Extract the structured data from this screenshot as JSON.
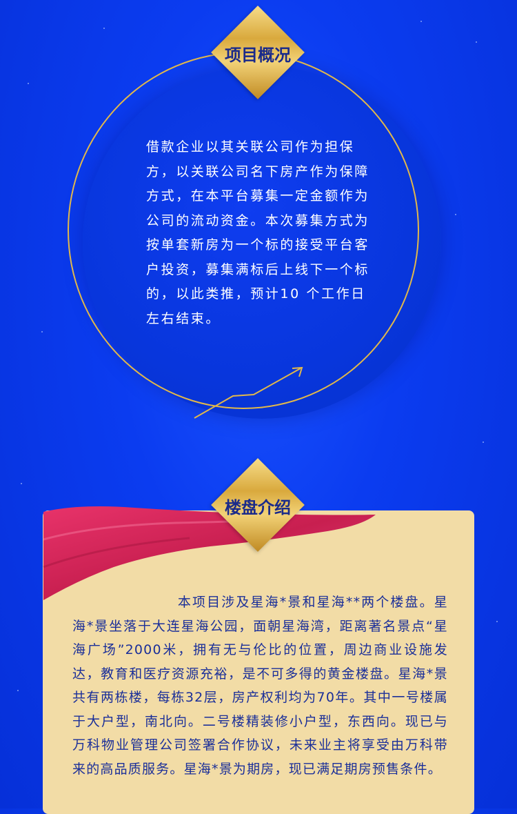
{
  "colors": {
    "background": "#0b3cf0",
    "gold": "#e2b84a",
    "card": "#f2dca6",
    "ribbon": "#d92a5e",
    "body_text_dark": "#1b2f99"
  },
  "project_overview": {
    "title": "项目概况",
    "body": "借款企业以其关联公司作为担保方，以关联公司名下房产作为保障方式，在本平台募集一定金额作为公司的流动资金。本次募集方式为按单套新房为一个标的接受平台客户投资，募集满标后上线下一个标的，以此类推，预计10 个工作日左右结束。"
  },
  "property_intro": {
    "title": "楼盘介绍",
    "body": "本项目涉及星海*景和星海**两个楼盘。星海*景坐落于大连星海公园，面朝星海湾，距离著名景点“星海广场”2000米，拥有无与伦比的位置，周边商业设施发达，教育和医疗资源充裕，是不可多得的黄金楼盘。星海*景共有两栋楼，每栋32层，房产权利均为70年。其中一号楼属于大户型，南北向。二号楼精装修小户型，东西向。现已与万科物业管理公司签署合作协议，未来业主将享受由万科带来的高品质服务。星海*景为期房，现已满足期房预售条件。"
  }
}
